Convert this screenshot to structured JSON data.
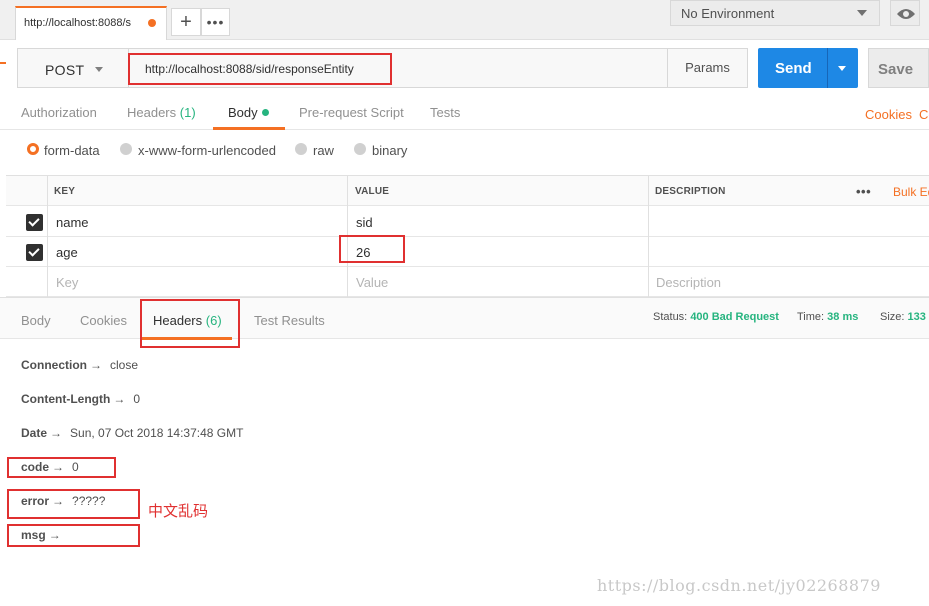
{
  "tab_bar": {
    "request_tab_title": "http://localhost:8088/s",
    "add_tab_icon": "plus-icon",
    "more_tabs_icon": "ellipsis-icon",
    "environment": "No Environment",
    "environment_caret_icon": "caret-down-icon",
    "environment_quicklook_icon": "eye-icon"
  },
  "url_bar": {
    "method": "POST",
    "url": "http://localhost:8088/sid/responseEntity",
    "params_label": "Params",
    "send_label": "Send",
    "save_label": "Save"
  },
  "request_tabs": {
    "authorization": "Authorization",
    "headers": "Headers",
    "headers_count": "(1)",
    "body": "Body",
    "pre_request_script": "Pre-request Script",
    "tests": "Tests",
    "cookies_link": "Cookies",
    "code_link": "Co",
    "active": "Body"
  },
  "body_types": {
    "options": [
      "form-data",
      "x-www-form-urlencoded",
      "raw",
      "binary"
    ],
    "selected": "form-data"
  },
  "form_table": {
    "columns": {
      "key": "KEY",
      "value": "VALUE",
      "description": "DESCRIPTION"
    },
    "bulk_edit": "Bulk Ed",
    "rows": [
      {
        "checked": true,
        "key": "name",
        "value": "sid",
        "description": ""
      },
      {
        "checked": true,
        "key": "age",
        "value": "26",
        "description": ""
      }
    ],
    "placeholders": {
      "key": "Key",
      "value": "Value",
      "description": "Description"
    }
  },
  "response_tabs": {
    "body": "Body",
    "cookies": "Cookies",
    "headers": "Headers",
    "headers_count": "(6)",
    "test_results": "Test Results",
    "active": "Headers"
  },
  "response_meta": {
    "status_label": "Status:",
    "status_value": "400 Bad Request",
    "time_label": "Time:",
    "time_value": "38 ms",
    "size_label": "Size:",
    "size_value": "133"
  },
  "response_headers": [
    {
      "key": "Connection",
      "value": "close"
    },
    {
      "key": "Content-Length",
      "value": "0"
    },
    {
      "key": "Date",
      "value": "Sun, 07 Oct 2018 14:37:48 GMT"
    },
    {
      "key": "code",
      "value": "0"
    },
    {
      "key": "error",
      "value": "?????"
    },
    {
      "key": "msg",
      "value": ""
    }
  ],
  "arrow": "→",
  "annotation_note": "中文乱码",
  "watermark": "https://blog.csdn.net/jy02268879",
  "colors": {
    "accent": "#f47023",
    "send_blue": "#1e88e5",
    "status_green": "#26b47f",
    "annotation_red": "#e03030"
  }
}
